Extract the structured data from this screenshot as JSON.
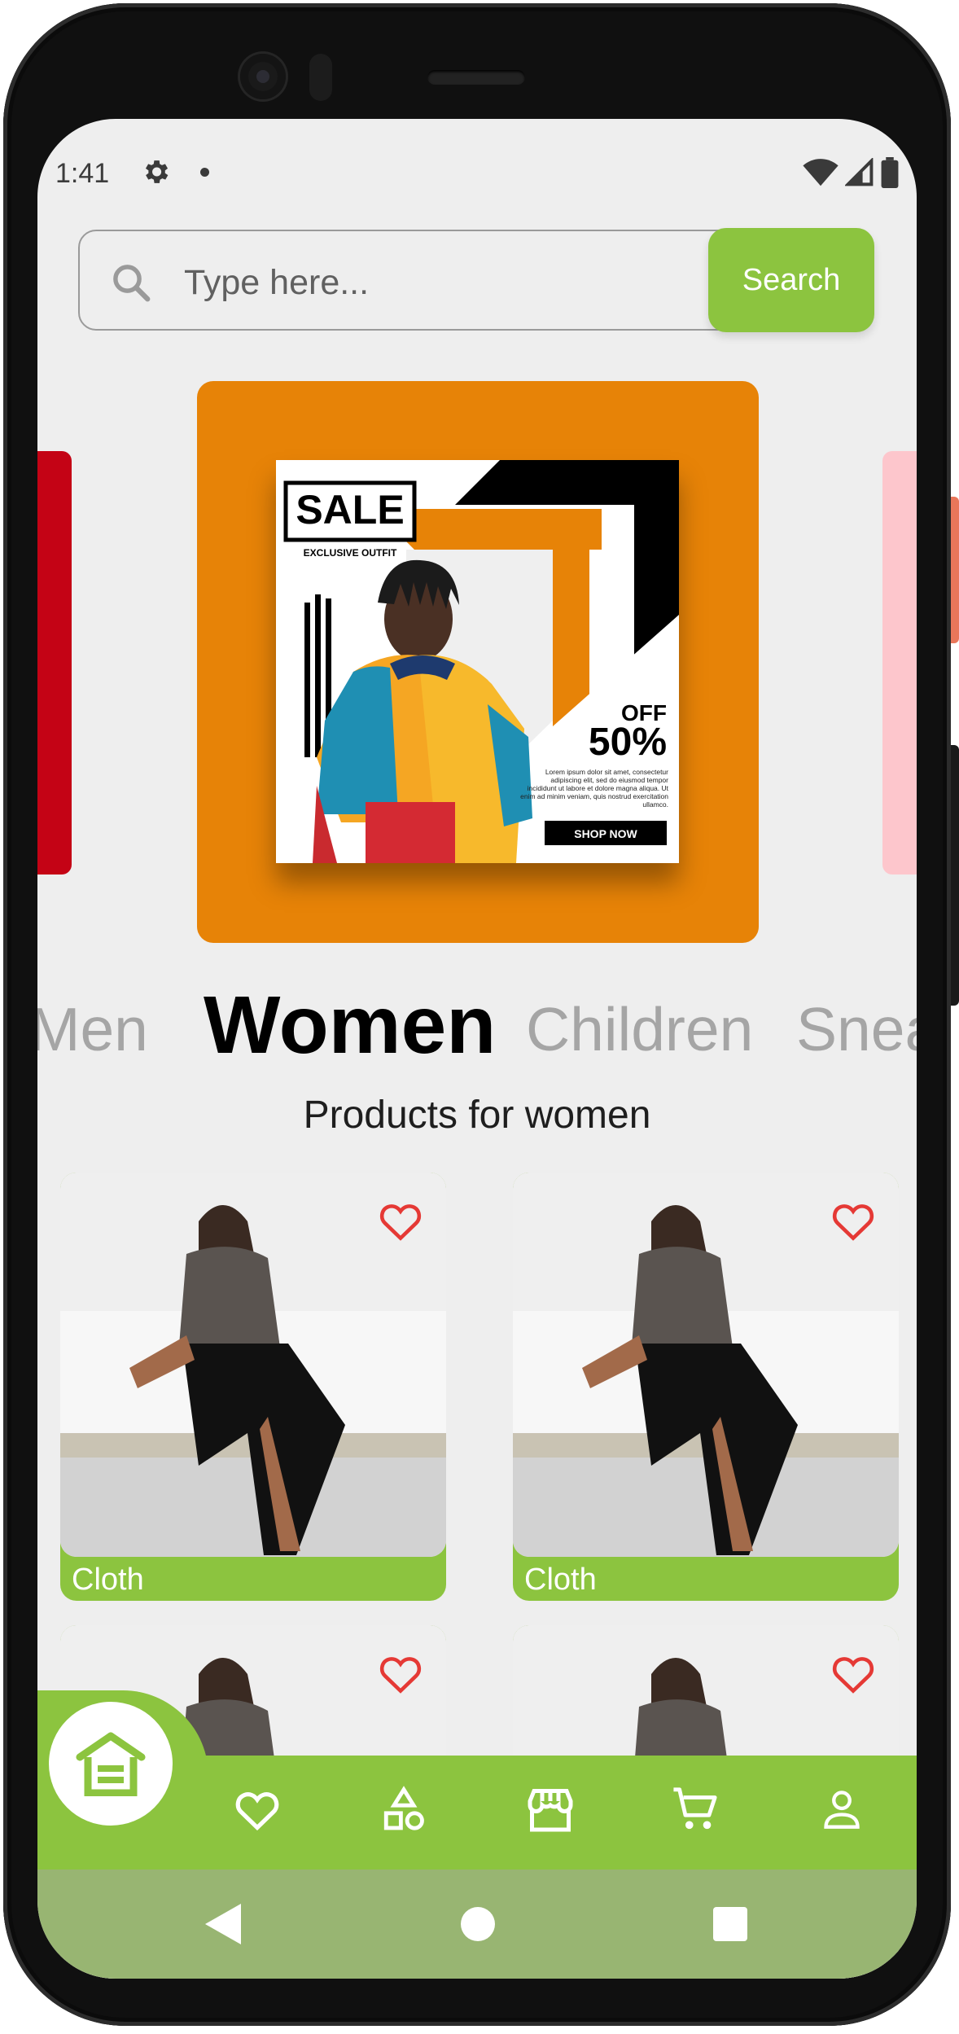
{
  "status_bar": {
    "time": "1:41"
  },
  "search": {
    "placeholder": "Type here...",
    "button_label": "Search"
  },
  "banner": {
    "sale": "SALE",
    "tagline": "EXCLUSIVE OUTFIT",
    "off_word": "OFF",
    "off_value": "50%",
    "body_text": "Lorem ipsum dolor sit amet, consectetur adipiscing elit, sed do eiusmod tempor incididunt ut labore et dolore magna aliqua. Ut enim ad minim veniam, quis nostrud exercitation ullamco.",
    "cta": "SHOP NOW"
  },
  "categories": [
    {
      "label": "Men",
      "active": false
    },
    {
      "label": "Women",
      "active": true
    },
    {
      "label": "Children",
      "active": false
    },
    {
      "label": "Snea",
      "active": false
    }
  ],
  "section_title": "Products for women",
  "products": [
    {
      "label": "Cloth"
    },
    {
      "label": "Cloth"
    },
    {
      "label": "",
      "partial": true
    },
    {
      "label": "",
      "partial": true
    }
  ],
  "bottom_nav": [
    "home-icon",
    "favorites-icon",
    "categories-icon",
    "store-icon",
    "cart-icon",
    "profile-icon"
  ],
  "colors": {
    "accent": "#8cc43f",
    "banner": "#e78307",
    "heart": "#e53935",
    "system_nav": "#98b572"
  }
}
